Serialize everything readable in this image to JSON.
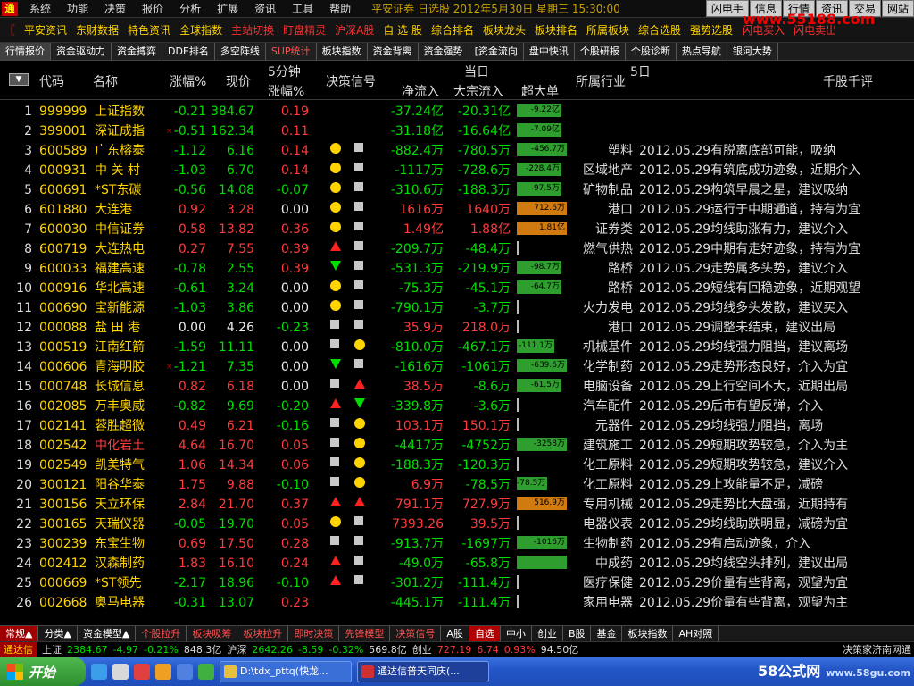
{
  "menubar": {
    "items": [
      "系统",
      "功能",
      "决策",
      "报价",
      "分析",
      "扩展",
      "资讯",
      "工具",
      "帮助"
    ],
    "center": "平安证券  日选股  2012年5月30日 星期三 15:30:00",
    "right_buttons": [
      "闪电手",
      "信息",
      "行情",
      "资讯",
      "交易",
      "网站"
    ]
  },
  "watermark": "www.55188.com",
  "toolbar": {
    "items": [
      "平安资讯",
      "东财数据",
      "特色资讯",
      "全球指数",
      "主站切换",
      "盯盘精灵",
      "沪深A股",
      "自 选 股",
      "综合排名",
      "板块龙头",
      "板块排名",
      "所属板块",
      "综合选股",
      "强势选股",
      "闪电买入",
      "闪电卖出"
    ],
    "open_bracket": "〖"
  },
  "tabs": [
    "行情报价",
    "资金驱动力",
    "资金搏弈",
    "DDE排名",
    "多空阵线",
    "SUP统计",
    "板块指数",
    "资金背离",
    "资金强势",
    "[资金流向",
    "盘中快讯",
    "个股研报",
    "个股诊断",
    "热点导航",
    "银河大势"
  ],
  "headers": {
    "sort": "▼",
    "code": "代码",
    "name": "名称",
    "change": "涨幅%",
    "price": "现价",
    "f5_top": "5分钟",
    "f5_bottom": "涨幅%",
    "decision": "决策信号",
    "day": "当日",
    "inflow": "净流入",
    "bulk": "大宗流入",
    "superbig": "超大单",
    "industry": "所属行业",
    "day5": "5日",
    "comment": "千股千评"
  },
  "rows": [
    {
      "i": "1",
      "code": "999999",
      "name": "上证指数",
      "mark": "",
      "chg": "-0.21",
      "price": "384.67",
      "f5": "0.19",
      "s1": "",
      "s2": "",
      "inflow": "-37.24亿",
      "bulk": "-20.31亿",
      "bar": "g",
      "bar_frac": 0.9,
      "bar_label": "-9.22亿",
      "ind": "",
      "cmt": ""
    },
    {
      "i": "2",
      "code": "399001",
      "name": "深证成指",
      "mark": "×",
      "chg": "-0.51",
      "price": "162.34",
      "f5": "0.11",
      "s1": "",
      "s2": "",
      "inflow": "-31.18亿",
      "bulk": "-16.64亿",
      "bar": "g",
      "bar_frac": 0.9,
      "bar_label": "-7.09亿",
      "ind": "",
      "cmt": ""
    },
    {
      "i": "3",
      "code": "600589",
      "name": "广东榕泰",
      "mark": "",
      "chg": "-1.12",
      "price": "6.16",
      "f5": "0.14",
      "s1": "dot",
      "s2": "sq",
      "inflow": "-882.4万",
      "bulk": "-780.5万",
      "bar": "g",
      "bar_frac": 1.0,
      "bar_label": "-456.7万",
      "ind": "塑料",
      "cmt": "2012.05.29有脱离底部可能，吸纳"
    },
    {
      "i": "4",
      "code": "000931",
      "name": "中 关 村",
      "mark": "",
      "chg": "-1.03",
      "price": "6.70",
      "f5": "0.14",
      "s1": "dot",
      "s2": "sq",
      "inflow": "-1117万",
      "bulk": "-728.6万",
      "bar": "g",
      "bar_frac": 0.9,
      "bar_label": "-228.4万",
      "ind": "区域地产",
      "cmt": "2012.05.29有筑底成功迹象，近期介入"
    },
    {
      "i": "5",
      "code": "600691",
      "name": "*ST东碳",
      "mark": "",
      "chg": "-0.56",
      "price": "14.08",
      "f5": "-0.07",
      "s1": "dot",
      "s2": "sq",
      "inflow": "-310.6万",
      "bulk": "-188.3万",
      "bar": "g",
      "bar_frac": 0.9,
      "bar_label": "-97.5万",
      "ind": "矿物制品",
      "cmt": "2012.05.29构筑早晨之星，建议吸纳"
    },
    {
      "i": "6",
      "code": "601880",
      "name": "大连港",
      "mark": "",
      "chg": "0.92",
      "price": "3.28",
      "f5": "0.00",
      "s1": "dot",
      "s2": "sq",
      "inflow": "1616万",
      "bulk": "1640万",
      "bar": "o",
      "bar_frac": 1.0,
      "bar_label": "712.6万",
      "ind": "港口",
      "cmt": "2012.05.29运行于中期通道，持有为宜"
    },
    {
      "i": "7",
      "code": "600030",
      "name": "中信证券",
      "mark": "",
      "chg": "0.58",
      "price": "13.82",
      "f5": "0.36",
      "s1": "dot",
      "s2": "sq",
      "inflow": "1.49亿",
      "bulk": "1.88亿",
      "bar": "o",
      "bar_frac": 1.0,
      "bar_label": "1.81亿",
      "ind": "证券类",
      "cmt": "2012.05.29均线助涨有力，建议介入"
    },
    {
      "i": "8",
      "code": "600719",
      "name": "大连热电",
      "mark": "",
      "chg": "0.27",
      "price": "7.55",
      "f5": "0.39",
      "s1": "up",
      "s2": "sq",
      "inflow": "-209.7万",
      "bulk": "-48.4万",
      "bar": "thin",
      "bar_frac": 0.05,
      "bar_label": "",
      "ind": "燃气供热",
      "cmt": "2012.05.29中期有走好迹象，持有为宜"
    },
    {
      "i": "9",
      "code": "600033",
      "name": "福建高速",
      "mark": "",
      "chg": "-0.78",
      "price": "2.55",
      "f5": "0.39",
      "s1": "dn",
      "s2": "sq",
      "inflow": "-531.3万",
      "bulk": "-219.9万",
      "bar": "g",
      "bar_frac": 0.9,
      "bar_label": "-98.7万",
      "ind": "路桥",
      "cmt": "2012.05.29走势属多头势，建议介入"
    },
    {
      "i": "10",
      "code": "000916",
      "name": "华北高速",
      "mark": "",
      "chg": "-0.61",
      "price": "3.24",
      "f5": "0.00",
      "s1": "dot",
      "s2": "sq",
      "inflow": "-75.3万",
      "bulk": "-45.1万",
      "bar": "g",
      "bar_frac": 0.9,
      "bar_label": "-64.7万",
      "ind": "路桥",
      "cmt": "2012.05.29短线有回稳迹象，近期观望"
    },
    {
      "i": "11",
      "code": "000690",
      "name": "宝新能源",
      "mark": "",
      "chg": "-1.03",
      "price": "3.86",
      "f5": "0.00",
      "s1": "dot",
      "s2": "sq",
      "inflow": "-790.1万",
      "bulk": "-3.7万",
      "bar": "thin",
      "bar_frac": 0.05,
      "bar_label": "",
      "ind": "火力发电",
      "cmt": "2012.05.29均线多头发散，建议买入"
    },
    {
      "i": "12",
      "code": "000088",
      "name": "盐 田 港",
      "mark": "",
      "chg": "0.00",
      "price": "4.26",
      "f5": "-0.23",
      "s1": "sq",
      "s2": "sq",
      "inflow": "35.9万",
      "bulk": "218.0万",
      "bar": "thin",
      "bar_frac": 0.05,
      "bar_label": "",
      "ind": "港口",
      "cmt": "2012.05.29调整未结束，建议出局"
    },
    {
      "i": "13",
      "code": "000519",
      "name": "江南红箭",
      "mark": "",
      "chg": "-1.59",
      "price": "11.11",
      "f5": "0.00",
      "s1": "sq",
      "s2": "dot",
      "inflow": "-810.0万",
      "bulk": "-467.1万",
      "bar": "g",
      "bar_frac": 0.75,
      "bar_label": "-111.1万",
      "ind": "机械基件",
      "cmt": "2012.05.29均线强力阻挡，建议离场"
    },
    {
      "i": "14",
      "code": "000606",
      "name": "青海明胶",
      "mark": "×",
      "chg": "-1.21",
      "price": "7.35",
      "f5": "0.00",
      "s1": "dn",
      "s2": "sq",
      "inflow": "-1616万",
      "bulk": "-1061万",
      "bar": "g",
      "bar_frac": 1.0,
      "bar_label": "-639.6万",
      "ind": "化学制药",
      "cmt": "2012.05.29走势形态良好，介入为宜"
    },
    {
      "i": "15",
      "code": "000748",
      "name": "长城信息",
      "mark": "",
      "chg": "0.82",
      "price": "6.18",
      "f5": "0.00",
      "s1": "sq",
      "s2": "up",
      "inflow": "38.5万",
      "bulk": "-8.6万",
      "bar": "g",
      "bar_frac": 0.9,
      "bar_label": "-61.5万",
      "ind": "电脑设备",
      "cmt": "2012.05.29上行空间不大，近期出局"
    },
    {
      "i": "16",
      "code": "002085",
      "name": "万丰奥威",
      "mark": "",
      "chg": "-0.82",
      "price": "9.69",
      "f5": "-0.20",
      "s1": "up",
      "s2": "dn",
      "inflow": "-339.8万",
      "bulk": "-3.6万",
      "bar": "thin",
      "bar_frac": 0.05,
      "bar_label": "",
      "ind": "汽车配件",
      "cmt": "2012.05.29后市有望反弹，介入"
    },
    {
      "i": "17",
      "code": "002141",
      "name": "蓉胜超微",
      "mark": "",
      "chg": "0.49",
      "price": "6.21",
      "f5": "-0.16",
      "s1": "sq",
      "s2": "dot",
      "inflow": "103.1万",
      "bulk": "150.1万",
      "bar": "thin",
      "bar_frac": 0.05,
      "bar_label": "",
      "ind": "元器件",
      "cmt": "2012.05.29均线强力阻挡，离场"
    },
    {
      "i": "18",
      "code": "002542",
      "name": "中化岩土",
      "mark": "",
      "chg": "4.64",
      "price": "16.70",
      "f5": "0.05",
      "s1": "sq",
      "s2": "dot",
      "inflow": "-4417万",
      "bulk": "-4752万",
      "bar": "g",
      "bar_frac": 1.0,
      "bar_label": "-3258万",
      "ind": "建筑施工",
      "cmt": "2012.05.29短期攻势较急，介入为主"
    },
    {
      "i": "19",
      "code": "002549",
      "name": "凯美特气",
      "mark": "",
      "chg": "1.06",
      "price": "14.34",
      "f5": "0.06",
      "s1": "sq",
      "s2": "dot",
      "inflow": "-188.3万",
      "bulk": "-120.3万",
      "bar": "thin",
      "bar_frac": 0.05,
      "bar_label": "",
      "ind": "化工原料",
      "cmt": "2012.05.29短期攻势较急，建议介入"
    },
    {
      "i": "20",
      "code": "300121",
      "name": "阳谷华泰",
      "mark": "",
      "chg": "1.75",
      "price": "9.88",
      "f5": "-0.10",
      "s1": "sq",
      "s2": "dot",
      "inflow": "6.9万",
      "bulk": "-78.5万",
      "bar": "g",
      "bar_frac": 0.6,
      "bar_label": "-78.5万",
      "ind": "化工原料",
      "cmt": "2012.05.29上攻能量不足，减磅"
    },
    {
      "i": "21",
      "code": "300156",
      "name": "天立环保",
      "mark": "",
      "chg": "2.84",
      "price": "21.70",
      "f5": "0.37",
      "s1": "up",
      "s2": "up",
      "inflow": "791.1万",
      "bulk": "727.9万",
      "bar": "o",
      "bar_frac": 1.0,
      "bar_label": "516.9万",
      "ind": "专用机械",
      "cmt": "2012.05.29走势比大盘强，近期持有"
    },
    {
      "i": "22",
      "code": "300165",
      "name": "天瑞仪器",
      "mark": "",
      "chg": "-0.05",
      "price": "19.70",
      "f5": "0.05",
      "s1": "dot",
      "s2": "sq",
      "inflow": "7393.26",
      "bulk": "39.5万",
      "bar": "thin",
      "bar_frac": 0.05,
      "bar_label": "",
      "ind": "电器仪表",
      "cmt": "2012.05.29均线助跌明显，减磅为宜"
    },
    {
      "i": "23",
      "code": "300239",
      "name": "东宝生物",
      "mark": "",
      "chg": "0.69",
      "price": "17.50",
      "f5": "0.28",
      "s1": "sq",
      "s2": "sq",
      "inflow": "-913.7万",
      "bulk": "-1697万",
      "bar": "g",
      "bar_frac": 1.0,
      "bar_label": "-1016万",
      "ind": "生物制药",
      "cmt": "2012.05.29有启动迹象，介入"
    },
    {
      "i": "24",
      "code": "002412",
      "name": "汉森制药",
      "mark": "",
      "chg": "1.83",
      "price": "16.10",
      "f5": "0.24",
      "s1": "up",
      "s2": "sq",
      "inflow": "-49.0万",
      "bulk": "-65.8万",
      "bar": "g",
      "bar_frac": 1.0,
      "bar_label": "",
      "ind": "中成药",
      "cmt": "2012.05.29均线空头排列，建议出局"
    },
    {
      "i": "25",
      "code": "000669",
      "name": "*ST领先",
      "mark": "",
      "chg": "-2.17",
      "price": "18.96",
      "f5": "-0.10",
      "s1": "up",
      "s2": "sq",
      "inflow": "-301.2万",
      "bulk": "-111.4万",
      "bar": "thin",
      "bar_frac": 0.05,
      "bar_label": "",
      "ind": "医疗保健",
      "cmt": "2012.05.29价量有些背离，观望为宜"
    },
    {
      "i": "26",
      "code": "002668",
      "name": "奥马电器",
      "mark": "",
      "chg": "-0.31",
      "price": "13.07",
      "f5": "0.23",
      "s1": "",
      "s2": "",
      "inflow": "-445.1万",
      "bulk": "-111.4万",
      "bar": "thin",
      "bar_frac": 0.05,
      "bar_label": "",
      "ind": "家用电器",
      "cmt": "2012.05.29价量有些背离，观望为主"
    }
  ],
  "bottom_tabs": [
    "常规▲",
    "分类▲",
    "资金模型▲",
    "个股拉升",
    "板块吸筹",
    "板块拉升",
    "即时决策",
    "先锋模型",
    "决策信号",
    "A股",
    "自选",
    "中小",
    "创业",
    "B股",
    "基金",
    "板块指数",
    "AH对照"
  ],
  "status": {
    "brand": "通达信",
    "sh_label": "上证",
    "sh_index": "2384.67",
    "sh_chg": "-4.97",
    "sh_pct": "-0.21%",
    "sh_amt": "848.3亿",
    "sz_label": "沪深",
    "sz_index": "2642.26",
    "sz_chg": "-8.59",
    "sz_pct": "-0.32%",
    "sz_amt": "569.8亿",
    "cy_label": "创业",
    "cy_index": "727.19",
    "cy_chg": "6.74",
    "cy_pct": "0.93%",
    "cy_amt": "94.50亿",
    "right": "决策家济南网通"
  },
  "taskbar": {
    "start": "开始",
    "tasks": [
      "D:\\tdx_pttq(快龙...",
      "通达信普天同庆(..."
    ],
    "logo": "58公式网",
    "url": "www.58gu.com"
  },
  "colors": {
    "up": "#ff3b3b",
    "down": "#00e000",
    "accent": "#ffd400"
  }
}
